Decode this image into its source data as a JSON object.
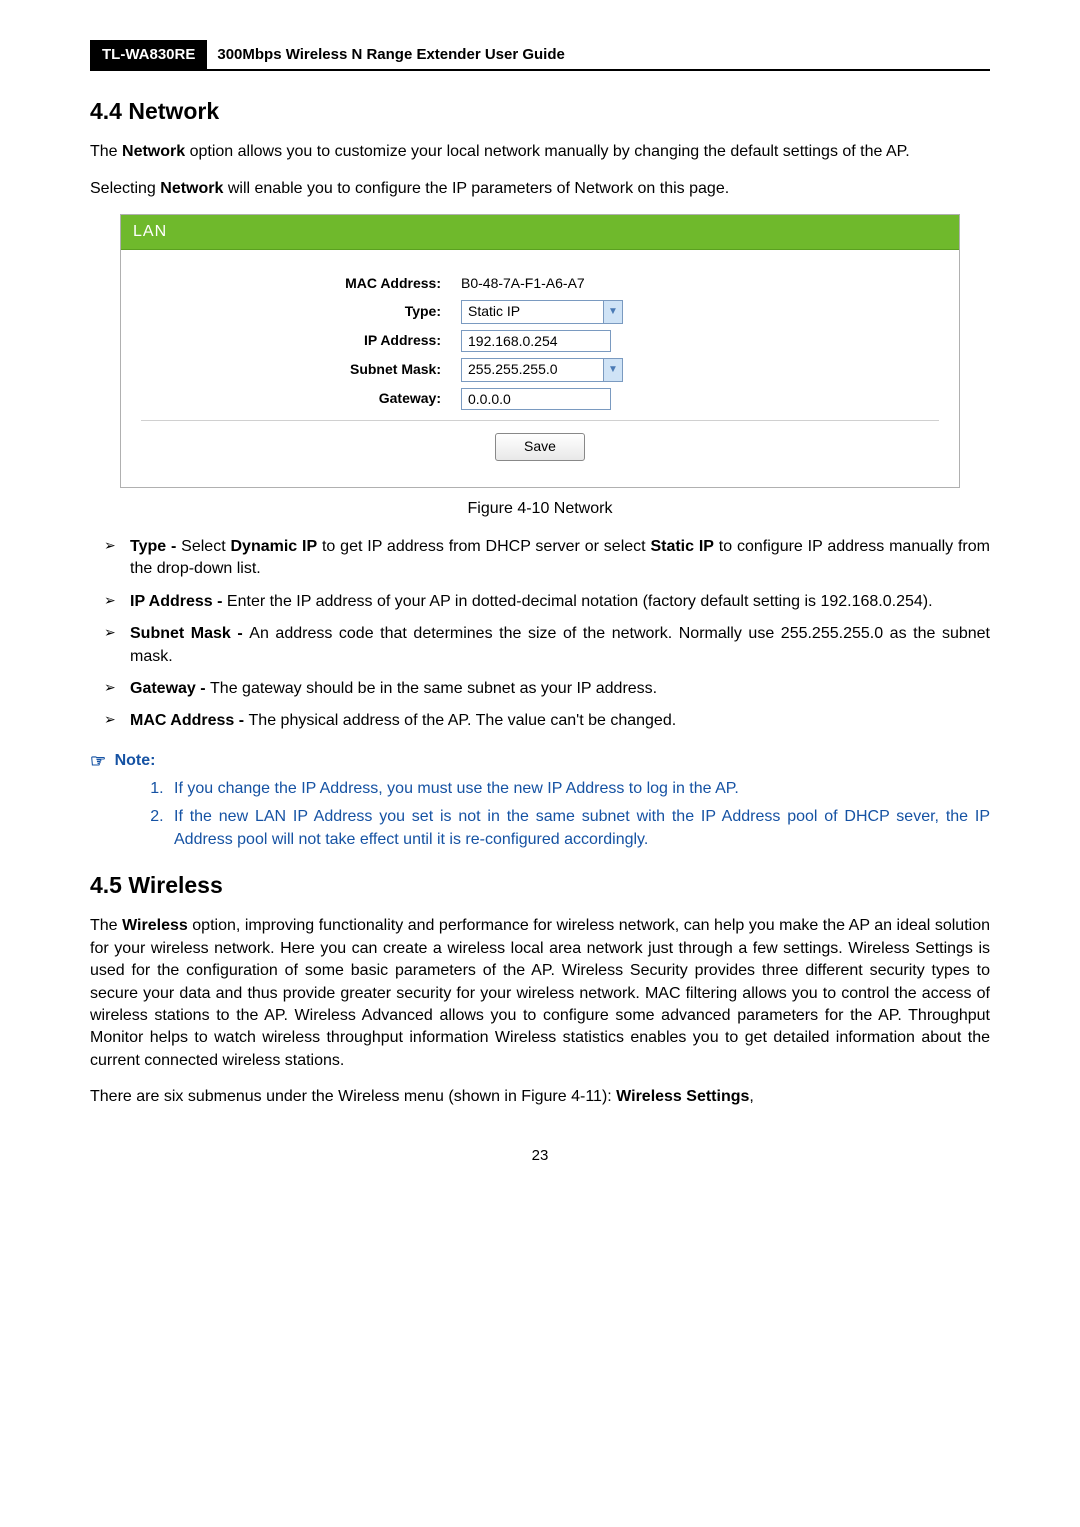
{
  "header": {
    "model": "TL-WA830RE",
    "guide_title": "300Mbps Wireless N Range Extender User Guide"
  },
  "section44": {
    "heading": "4.4   Network",
    "p1_part1": "The ",
    "p1_bold": "Network",
    "p1_part2": " option allows you to customize your local network manually by changing the default settings of the AP.",
    "p2_part1": "Selecting ",
    "p2_bold": "Network",
    "p2_part2": " will enable you to configure the IP parameters of Network on this page."
  },
  "lan_panel": {
    "title": "LAN",
    "rows": {
      "mac_label": "MAC Address:",
      "mac_value": "B0-48-7A-F1-A6-A7",
      "type_label": "Type:",
      "type_value": "Static IP",
      "ip_label": "IP Address:",
      "ip_value": "192.168.0.254",
      "subnet_label": "Subnet Mask:",
      "subnet_value": "255.255.255.0",
      "gateway_label": "Gateway:",
      "gateway_value": "0.0.0.0"
    },
    "save_button": "Save"
  },
  "figure_caption": "Figure 4-10 Network",
  "bullets": {
    "type": {
      "term": "Type - ",
      "seg1": "Select ",
      "b1": "Dynamic IP",
      "seg2": " to get IP address from DHCP server or select ",
      "b2": "Static IP",
      "seg3": " to configure IP address manually from the drop-down list."
    },
    "ip": {
      "term": "IP Address - ",
      "text": "Enter the IP address of your AP in dotted-decimal notation (factory default setting is 192.168.0.254)."
    },
    "subnet": {
      "term": "Subnet Mask - ",
      "text": "An address code that determines the size of the network. Normally use 255.255.255.0 as the subnet mask."
    },
    "gateway": {
      "term": "Gateway - ",
      "text": "The gateway should be in the same subnet as your IP address."
    },
    "mac": {
      "term": "MAC Address - ",
      "text": "The physical address of the AP. The value can't be changed."
    }
  },
  "note_label": "Note:",
  "notes": {
    "n1": "If you change the IP Address, you must use the new IP Address to log in the AP.",
    "n2": "If the new LAN IP Address you set is not in the same subnet with the IP Address pool of DHCP sever, the IP Address pool will not take effect until it is re-configured accordingly."
  },
  "section45": {
    "heading": "4.5   Wireless",
    "p1_part1": "The ",
    "p1_bold": "Wireless",
    "p1_part2": " option, improving functionality and performance for wireless network, can help you make the AP an ideal solution for your wireless network. Here you can create a wireless local area network just through a few settings. Wireless Settings is used for the configuration of some basic parameters of the AP. Wireless Security provides three different security types to secure your data and thus provide greater security for your wireless network. MAC filtering allows you to control the access of wireless stations to the AP. Wireless Advanced allows you to configure some advanced parameters for the AP. Throughput Monitor helps to watch wireless throughput information Wireless statistics enables you to get detailed information about the current connected wireless stations.",
    "p2_part1": "There are six submenus under the Wireless menu (shown in Figure 4-11): ",
    "p2_bold": "Wireless Settings",
    "p2_part2": ","
  },
  "page_number": "23"
}
